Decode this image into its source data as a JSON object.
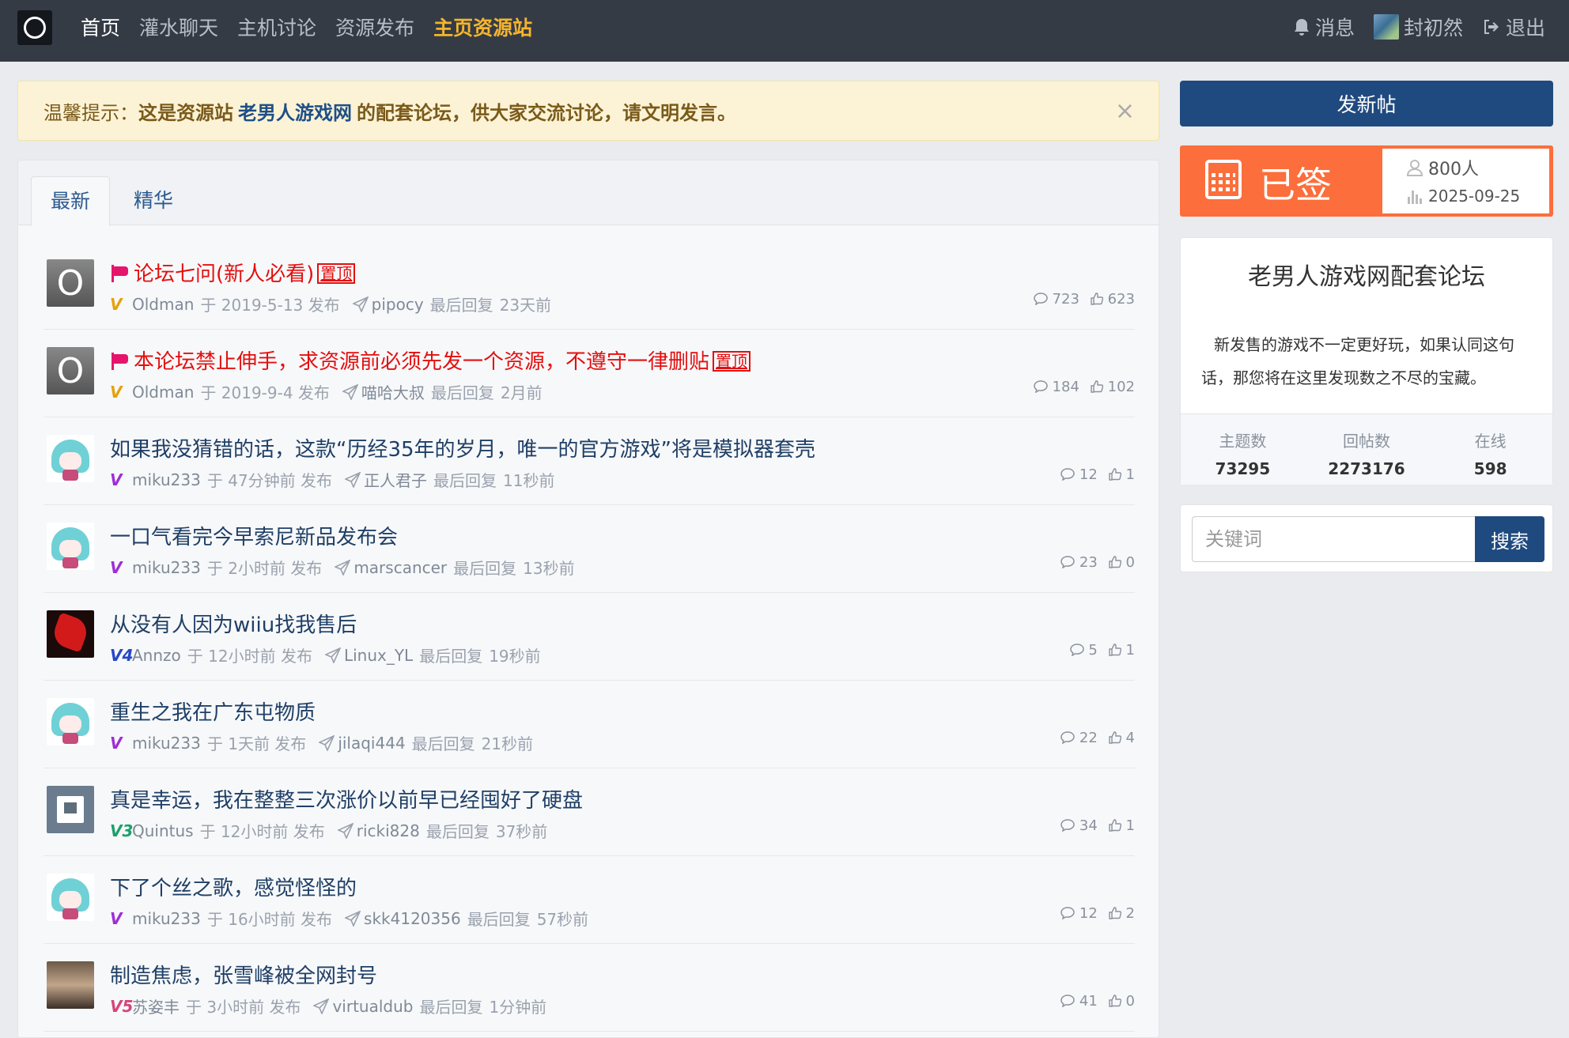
{
  "nav": {
    "items": [
      {
        "label": "首页",
        "state": "active"
      },
      {
        "label": "灌水聊天",
        "state": ""
      },
      {
        "label": "主机讨论",
        "state": ""
      },
      {
        "label": "资源发布",
        "state": ""
      },
      {
        "label": "主页资源站",
        "state": "highlight"
      }
    ],
    "messages": "消息",
    "username": "封初然",
    "logout": "退出"
  },
  "notice": {
    "prefix": "温馨提示：",
    "part1": "这是资源站",
    "site": "老男人游戏网",
    "part2": "的配套论坛，供大家交流讨论，请文明发言。",
    "close": "×"
  },
  "tabs": [
    "最新",
    "精华"
  ],
  "topics": [
    {
      "title": "论坛七问(新人必看)",
      "pinned": true,
      "pin_label": "置顶",
      "avatar": "o",
      "level": "v-gold",
      "level_text": "V",
      "author": "Oldman",
      "posted": "于 2019-5-13 发布",
      "replier": "pipocy",
      "reply_label": "最后回复",
      "reply_time": "23天前",
      "replies": "723",
      "likes": "623"
    },
    {
      "title": "本论坛禁止伸手，求资源前必须先发一个资源，不遵守一律删贴",
      "pinned": true,
      "pin_label": "置顶",
      "avatar": "o",
      "level": "v-gold",
      "level_text": "V",
      "author": "Oldman",
      "posted": "于 2019-9-4 发布",
      "replier": "喵哈大叔",
      "reply_label": "最后回复",
      "reply_time": "2月前",
      "replies": "184",
      "likes": "102"
    },
    {
      "title": "如果我没猜错的话，这款“历经35年的岁月，唯一的官方游戏”将是模拟器套壳",
      "pinned": false,
      "avatar": "miku",
      "level": "v-purple",
      "level_text": "V",
      "author": "miku233",
      "posted": "于 47分钟前 发布",
      "replier": "正人君子",
      "reply_label": "最后回复",
      "reply_time": "11秒前",
      "replies": "12",
      "likes": "1"
    },
    {
      "title": "一口气看完今早索尼新品发布会",
      "pinned": false,
      "avatar": "miku",
      "level": "v-purple",
      "level_text": "V",
      "author": "miku233",
      "posted": "于 2小时前 发布",
      "replier": "marscancer",
      "reply_label": "最后回复",
      "reply_time": "13秒前",
      "replies": "23",
      "likes": "0"
    },
    {
      "title": "从没有人因为wiiu找我售后",
      "pinned": false,
      "avatar": "red",
      "level": "v-blue",
      "level_text": "V4",
      "author": "Annzo",
      "posted": "于 12小时前 发布",
      "replier": "Linux_YL",
      "reply_label": "最后回复",
      "reply_time": "19秒前",
      "replies": "5",
      "likes": "1"
    },
    {
      "title": "重生之我在广东屯物质",
      "pinned": false,
      "avatar": "miku",
      "level": "v-purple",
      "level_text": "V",
      "author": "miku233",
      "posted": "于 1天前 发布",
      "replier": "jilaqi444",
      "reply_label": "最后回复",
      "reply_time": "21秒前",
      "replies": "22",
      "likes": "4"
    },
    {
      "title": "真是幸运，我在整整三次涨价以前早已经囤好了硬盘",
      "pinned": false,
      "avatar": "twitch",
      "level": "v-green",
      "level_text": "V3",
      "author": "Quintus",
      "posted": "于 12小时前 发布",
      "replier": "ricki828",
      "reply_label": "最后回复",
      "reply_time": "37秒前",
      "replies": "34",
      "likes": "1"
    },
    {
      "title": "下了个丝之歌，感觉怪怪的",
      "pinned": false,
      "avatar": "miku",
      "level": "v-purple",
      "level_text": "V",
      "author": "miku233",
      "posted": "于 16小时前 发布",
      "replier": "skk4120356",
      "reply_label": "最后回复",
      "reply_time": "57秒前",
      "replies": "12",
      "likes": "2"
    },
    {
      "title": "制造焦虑，张雪峰被全网封号",
      "pinned": false,
      "avatar": "photo",
      "level": "v-pink",
      "level_text": "V5",
      "author": "苏姿丰",
      "posted": "于 3小时前 发布",
      "replier": "virtualdub",
      "reply_label": "最后回复",
      "reply_time": "1分钟前",
      "replies": "41",
      "likes": "0"
    }
  ],
  "sidebar": {
    "new_post": "发新帖",
    "sign_label": "已签",
    "sign_count": "800人",
    "sign_date": "2025-09-25",
    "forum_title": "老男人游戏网配套论坛",
    "forum_desc": "新发售的游戏不一定更好玩，如果认同这句话，那您将在这里发现数之不尽的宝藏。",
    "stats": [
      {
        "label": "主题数",
        "value": "73295"
      },
      {
        "label": "回帖数",
        "value": "2273176"
      },
      {
        "label": "在线",
        "value": "598"
      }
    ],
    "search_placeholder": "关键词",
    "search_button": "搜索"
  },
  "colors": {
    "header_bg": "#353b45",
    "accent": "#1f4a7f",
    "highlight": "#f5b52c",
    "sign_bg": "#fc6e3b",
    "pinned_title": "#e40f0f"
  }
}
